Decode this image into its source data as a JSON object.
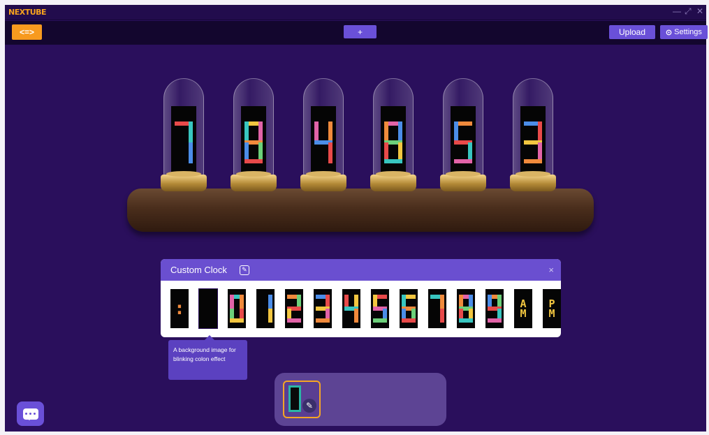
{
  "app": {
    "brand": "NEXTUBE"
  },
  "window_controls": [
    "—",
    "⤢",
    "✕"
  ],
  "toolbar": {
    "swap_label": "<=>",
    "plus_label": "+",
    "upload_label": "Upload",
    "settings_label": "Settings",
    "settings_icon": "gear-icon"
  },
  "clock": {
    "digits": [
      "7",
      "8",
      "4",
      "8",
      "5",
      "3"
    ],
    "colors": {
      "red": "#e84a4a",
      "yellow": "#f2c640",
      "teal": "#38c6c0",
      "pink": "#e263a8",
      "orange": "#f08a3c",
      "blue": "#4b8de8",
      "green": "#6cd07a"
    }
  },
  "panel": {
    "title": "Custom Clock",
    "close": "×",
    "glyphs": [
      ":",
      "",
      "0",
      "1",
      "2",
      "3",
      "4",
      "5",
      "6",
      "7",
      "8",
      "9",
      "A\nM",
      "P\nM"
    ]
  },
  "tooltip": {
    "text": "A background image for blinking colon effect"
  }
}
